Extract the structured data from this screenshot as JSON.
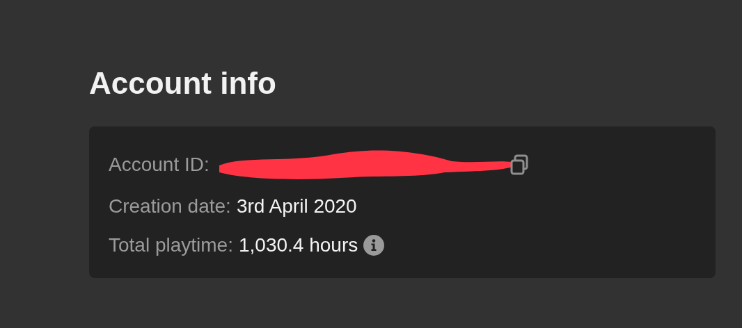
{
  "title": "Account info",
  "rows": [
    {
      "kind": "id",
      "label": "Account ID:"
    },
    {
      "kind": "text",
      "label": "Creation date:",
      "value": "3rd April 2020"
    },
    {
      "kind": "info",
      "label": "Total playtime:",
      "value": "1,030.4 hours"
    }
  ]
}
